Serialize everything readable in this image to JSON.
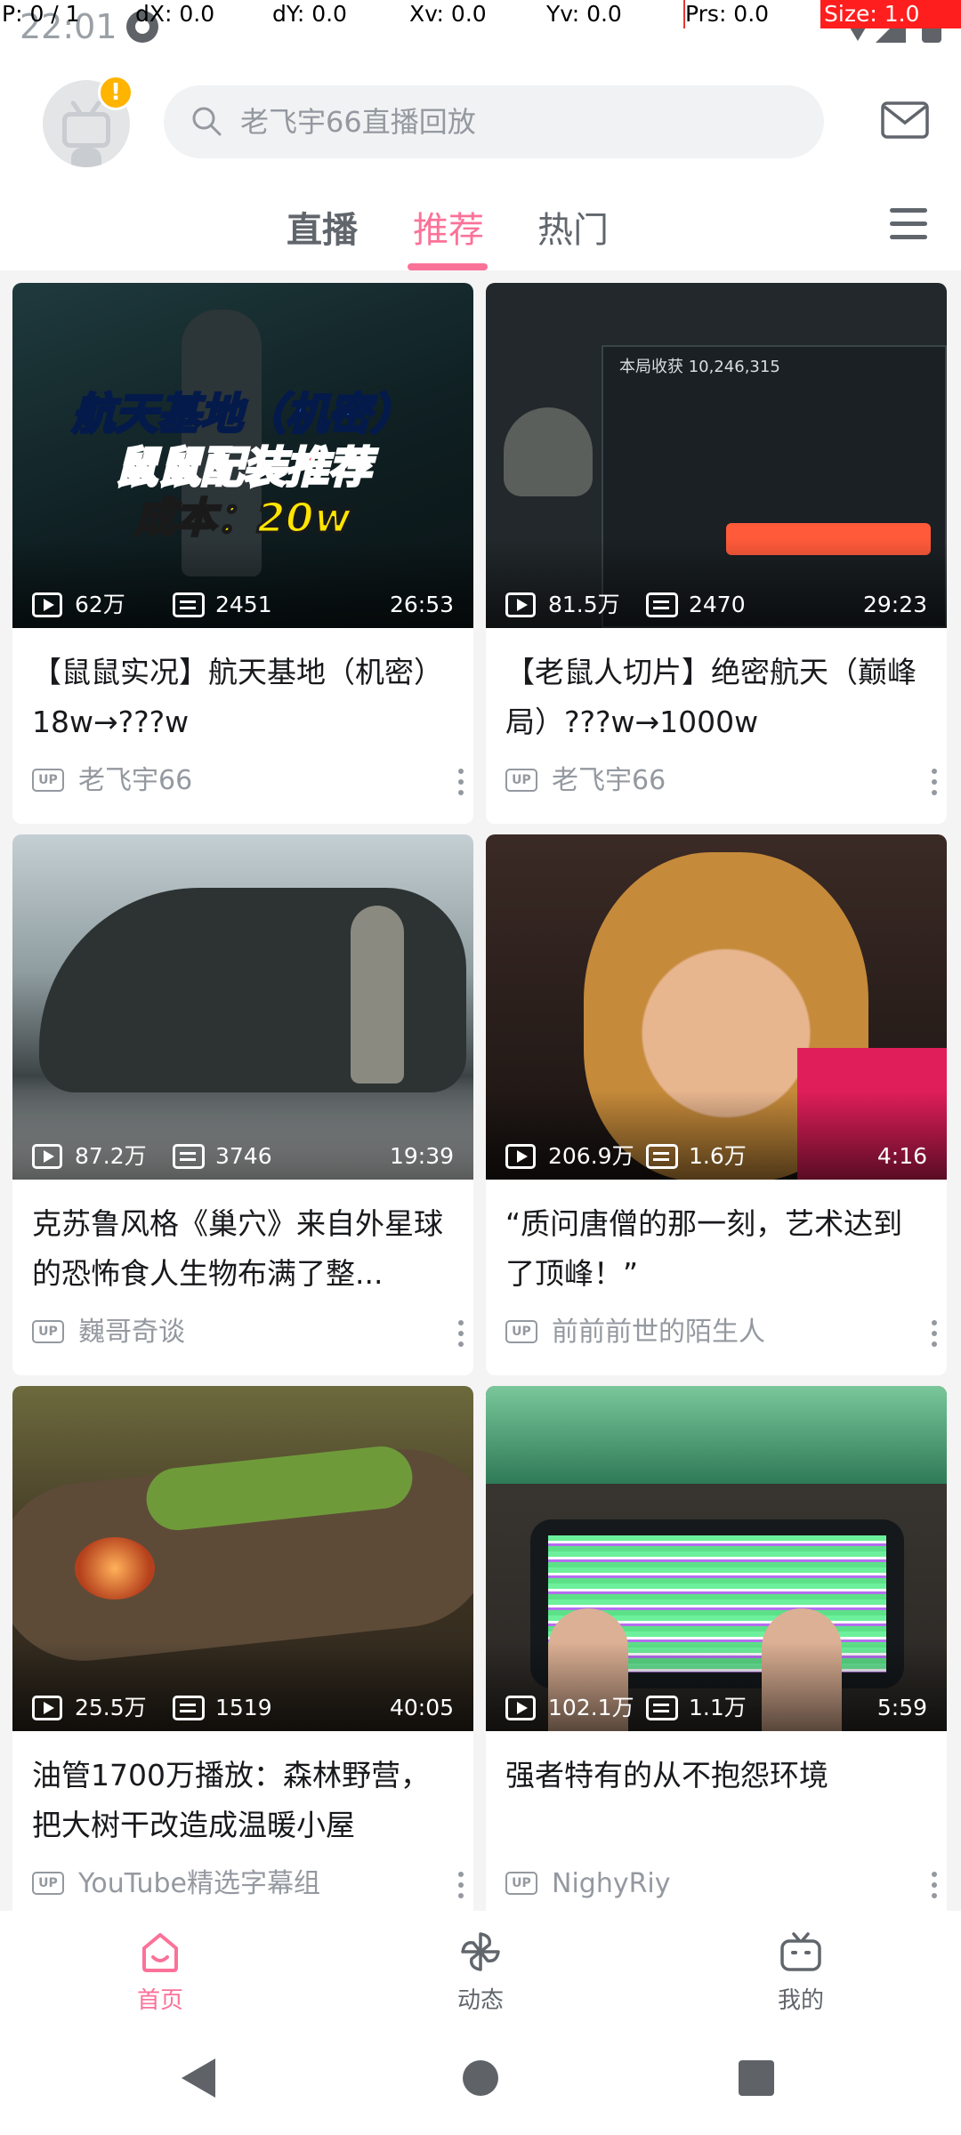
{
  "status_bar": {
    "time": "22:01"
  },
  "pointer_overlay": {
    "p": "P: 0 / 1",
    "dx": "dX: 0.0",
    "dy": "dY: 0.0",
    "xv": "Xv: 0.0",
    "yv": "Yv: 0.0",
    "prs": "Prs: 0.0",
    "size": "Size: 1.0"
  },
  "header": {
    "badge": "!",
    "search": {
      "placeholder": "老飞宇66直播回放"
    }
  },
  "tabs": [
    {
      "label": "直播",
      "active": false
    },
    {
      "label": "推荐",
      "active": true
    },
    {
      "label": "热门",
      "active": false
    }
  ],
  "feed": [
    {
      "views": "62万",
      "danmaku": "2451",
      "duration": "26:53",
      "title": "【鼠鼠实况】航天基地（机密）18w→???w",
      "up": "老飞宇66",
      "thumb_text": [
        "航天基地（机密）",
        "鼠鼠配装推荐",
        "成本：20w"
      ]
    },
    {
      "views": "81.5万",
      "danmaku": "2470",
      "duration": "29:23",
      "title": "【老鼠人切片】绝密航天（巅峰局）???w→1000w",
      "up": "老飞宇66",
      "thumb_text": [
        "本局收获  10,246,315"
      ]
    },
    {
      "views": "87.2万",
      "danmaku": "3746",
      "duration": "19:39",
      "title": "克苏鲁风格《巢穴》来自外星球的恐怖食人生物布满了整...",
      "up": "巍哥奇谈"
    },
    {
      "views": "206.9万",
      "danmaku": "1.6万",
      "duration": "4:16",
      "title": "“质问唐僧的那一刻，艺术达到了顶峰！”",
      "up": "前前前世的陌生人"
    },
    {
      "views": "25.5万",
      "danmaku": "1519",
      "duration": "40:05",
      "title": "油管1700万播放：森林野营，把大树干改造成温暖小屋",
      "up": "YouTube精选字幕组"
    },
    {
      "views": "102.1万",
      "danmaku": "1.1万",
      "duration": "5:59",
      "title": "强者特有的从不抱怨环境",
      "up": "NighyRiy"
    }
  ],
  "up_tag": "UP",
  "bottom_nav": [
    {
      "label": "首页",
      "icon": "home-icon",
      "active": true
    },
    {
      "label": "动态",
      "icon": "pinwheel-icon",
      "active": false
    },
    {
      "label": "我的",
      "icon": "tv-icon",
      "active": false
    }
  ],
  "colors": {
    "accent": "#fb7299",
    "text_secondary": "#9499a0",
    "background": "#f4f4f4"
  }
}
